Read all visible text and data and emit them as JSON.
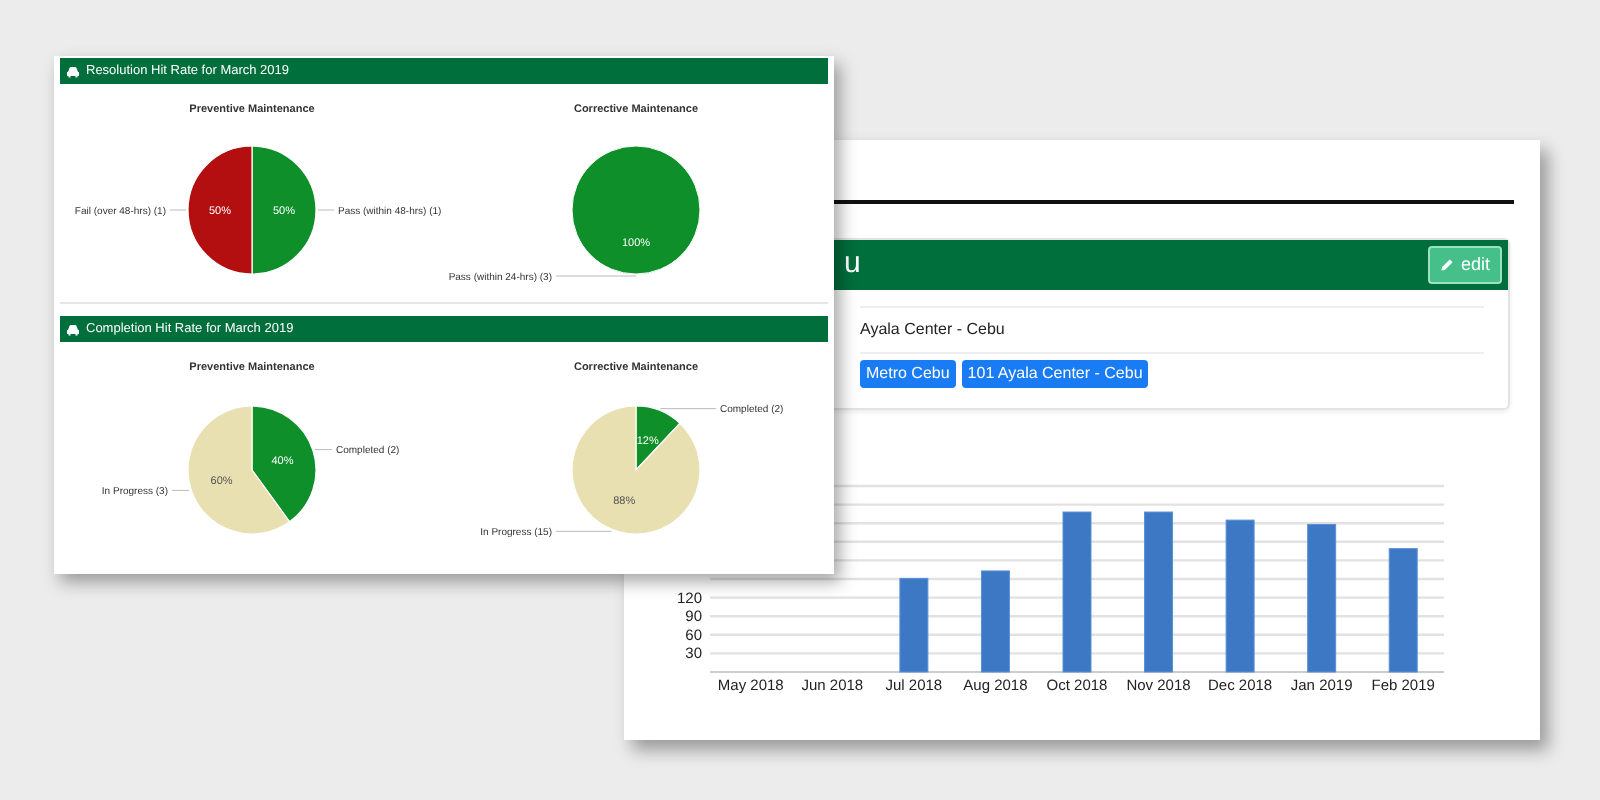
{
  "dashboard": {
    "sections": [
      {
        "title": "Resolution Hit Rate for March 2019",
        "charts": [
          {
            "chart_data": {
              "type": "pie",
              "title": "Preventive Maintenance",
              "categories": [
                "Pass (within 48-hrs) (1)",
                "Fail (over 48-hrs) (1)"
              ],
              "values": [
                50,
                50
              ],
              "colors": [
                "#0e8f2a",
                "#b30f10"
              ],
              "value_labels": [
                "50%",
                "50%"
              ]
            }
          },
          {
            "chart_data": {
              "type": "pie",
              "title": "Corrective Maintenance",
              "categories": [
                "Pass (within 24-hrs) (3)"
              ],
              "values": [
                100
              ],
              "colors": [
                "#0e8f2a"
              ],
              "value_labels": [
                "100%"
              ]
            }
          }
        ]
      },
      {
        "title": "Completion Hit Rate for March 2019",
        "charts": [
          {
            "chart_data": {
              "type": "pie",
              "title": "Preventive Maintenance",
              "categories": [
                "Completed (2)",
                "In Progress (3)"
              ],
              "values": [
                40,
                60
              ],
              "colors": [
                "#0e8f2a",
                "#e8e0b0"
              ],
              "value_labels": [
                "40%",
                "60%"
              ]
            }
          },
          {
            "chart_data": {
              "type": "pie",
              "title": "Corrective Maintenance",
              "categories": [
                "Completed (2)",
                "In Progress (15)"
              ],
              "values": [
                12,
                88
              ],
              "colors": [
                "#0e8f2a",
                "#e8e0b0"
              ],
              "value_labels": [
                "12%",
                "88%"
              ]
            }
          }
        ]
      }
    ]
  },
  "detail": {
    "header": {
      "title": "u",
      "edit_button": "edit"
    },
    "location": "Ayala Center - Cebu",
    "tags": [
      "Metro Cebu",
      "101 Ayala Center - Cebu"
    ],
    "chart_data": {
      "type": "bar",
      "categories": [
        "May 2018",
        "Jun 2018",
        "Jul 2018",
        "Aug 2018",
        "Oct 2018",
        "Nov 2018",
        "Dec 2018",
        "Jan 2019",
        "Feb 2019"
      ],
      "series": [
        {
          "color": "#3d78c4",
          "values": [
            null,
            null,
            151,
            163,
            258,
            258,
            245,
            238,
            199
          ]
        }
      ],
      "ylim": [
        0,
        300
      ],
      "yticks": [
        30,
        60,
        90,
        120
      ],
      "grid": true
    }
  }
}
